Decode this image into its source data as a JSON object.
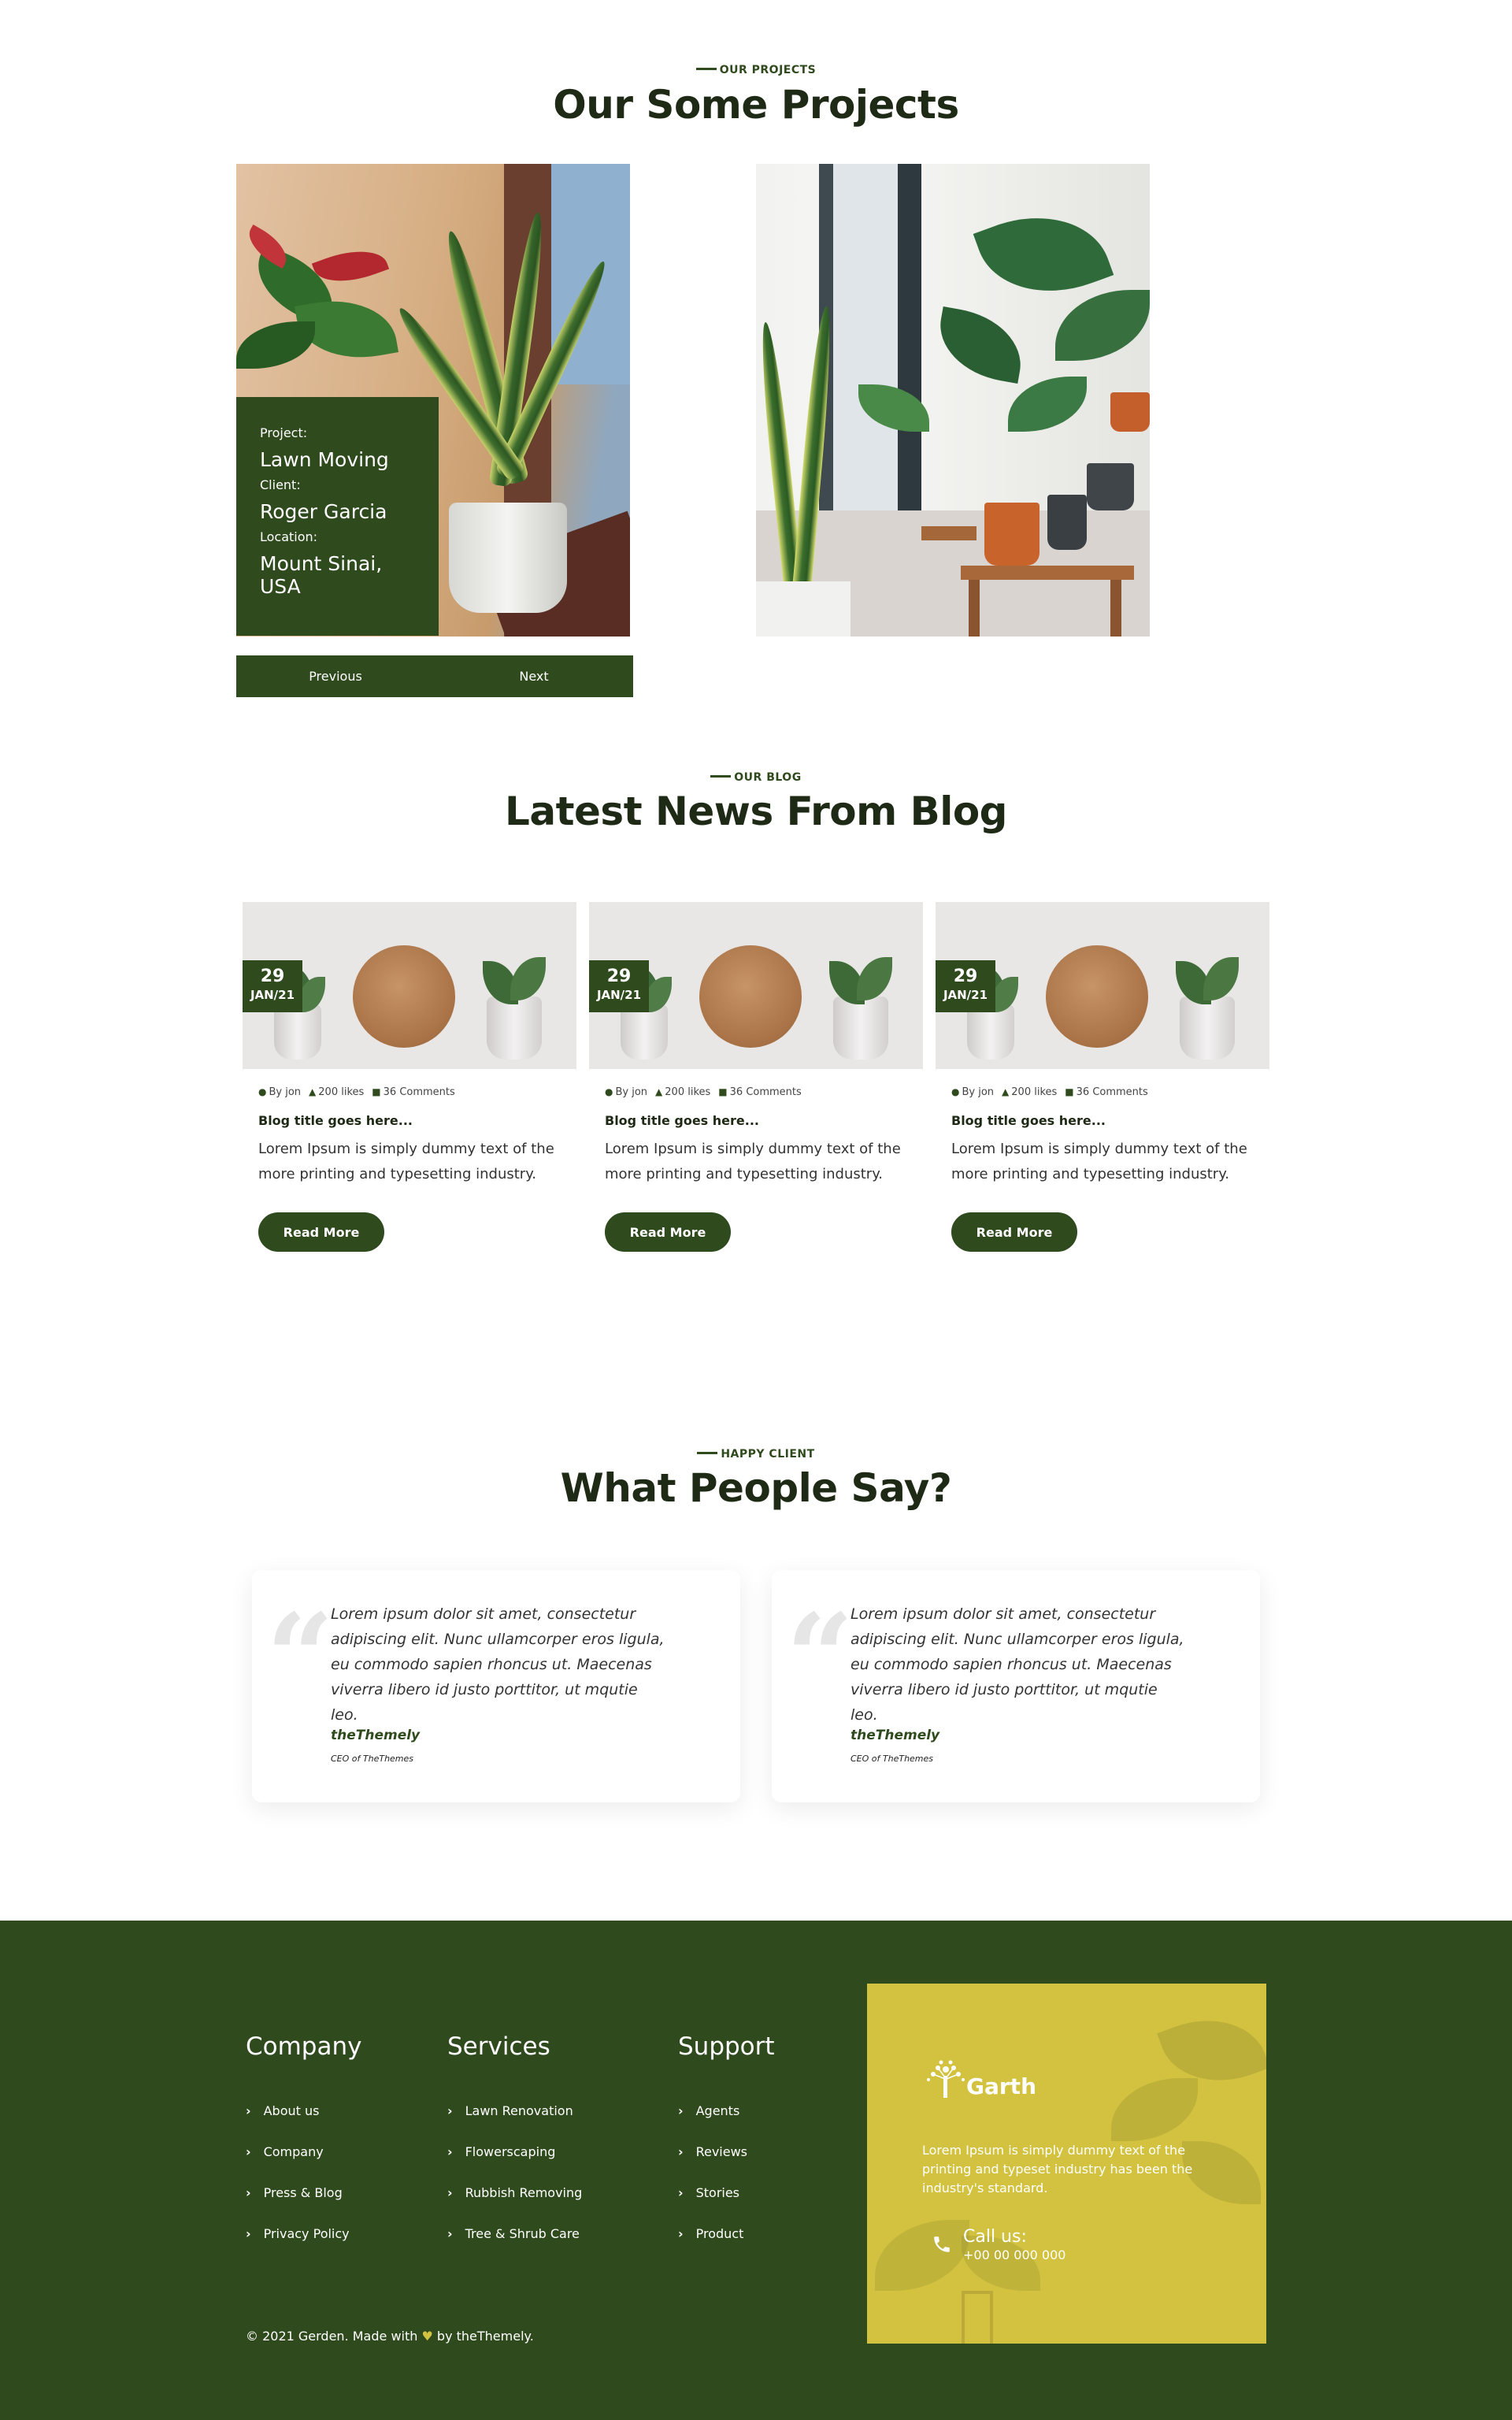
{
  "projects": {
    "eyebrow": "OUR PROJECTS",
    "title": "Our Some Projects",
    "card": {
      "project_label": "Project:",
      "project_value": "Lawn Moving",
      "client_label": "Client:",
      "client_value": "Roger Garcia",
      "location_label": "Location:",
      "location_value": "Mount Sinai, USA"
    },
    "nav": {
      "previous": "Previous",
      "next": "Next"
    }
  },
  "blog": {
    "eyebrow": "OUR BLOG",
    "title": "Latest News From Blog",
    "posts": [
      {
        "day": "29",
        "month": "JAN/21",
        "author": "By jon",
        "likes": "200 likes",
        "comments": "36 Comments",
        "title": "Blog title goes here...",
        "excerpt": "Lorem Ipsum is simply dummy text of the more printing and typesetting industry.",
        "cta": "Read More"
      },
      {
        "day": "29",
        "month": "JAN/21",
        "author": "By jon",
        "likes": "200 likes",
        "comments": "36 Comments",
        "title": "Blog title goes here...",
        "excerpt": "Lorem Ipsum is simply dummy text of the more printing and typesetting industry.",
        "cta": "Read More"
      },
      {
        "day": "29",
        "month": "JAN/21",
        "author": "By jon",
        "likes": "200 likes",
        "comments": "36 Comments",
        "title": "Blog title goes here...",
        "excerpt": "Lorem Ipsum is simply dummy text of the more printing and typesetting industry.",
        "cta": "Read More"
      }
    ]
  },
  "testimonials": {
    "eyebrow": "HAPPY CLIENT",
    "title": "What People Say?",
    "items": [
      {
        "text": "Lorem ipsum dolor sit amet, consectetur adipiscing elit. Nunc ullamcorper eros ligula, eu commodo sapien rhoncus ut. Maecenas viverra libero id justo porttitor, ut mqutie leo.",
        "name": "theThemely",
        "role": "CEO of TheThemes"
      },
      {
        "text": "Lorem ipsum dolor sit amet, consectetur adipiscing elit. Nunc ullamcorper eros ligula, eu commodo sapien rhoncus ut. Maecenas viverra libero id justo porttitor, ut mqutie leo.",
        "name": "theThemely",
        "role": "CEO of TheThemes"
      }
    ]
  },
  "footer": {
    "columns": [
      {
        "title": "Company",
        "links": [
          "About us",
          "Company",
          "Press & Blog",
          "Privacy Policy"
        ]
      },
      {
        "title": "Services",
        "links": [
          "Lawn Renovation",
          "Flowerscaping",
          "Rubbish Removing",
          "Tree & Shrub Care"
        ]
      },
      {
        "title": "Support",
        "links": [
          "Agents",
          "Reviews",
          "Stories",
          "Product"
        ]
      }
    ],
    "copyright_prefix": "© 2021 Gerden. Made with",
    "copyright_suffix": "by theThemely.",
    "promo": {
      "brand": "Garth",
      "text": "Lorem Ipsum is simply dummy text of the printing and typeset industry has been the industry's standard.",
      "call_title": "Call us:",
      "call_number": "+00 00 000 000"
    }
  },
  "colors": {
    "primary": "#2f4a1d",
    "accent": "#d2c23f",
    "heading": "#1e2a16"
  },
  "icons": {
    "user": "user-icon",
    "like": "thumbs-up-icon",
    "comment": "comment-icon",
    "chevron": "chevron-right-icon",
    "phone": "phone-icon",
    "heart": "heart-icon",
    "logo": "tree-logo-icon",
    "quote": "quote-icon"
  }
}
